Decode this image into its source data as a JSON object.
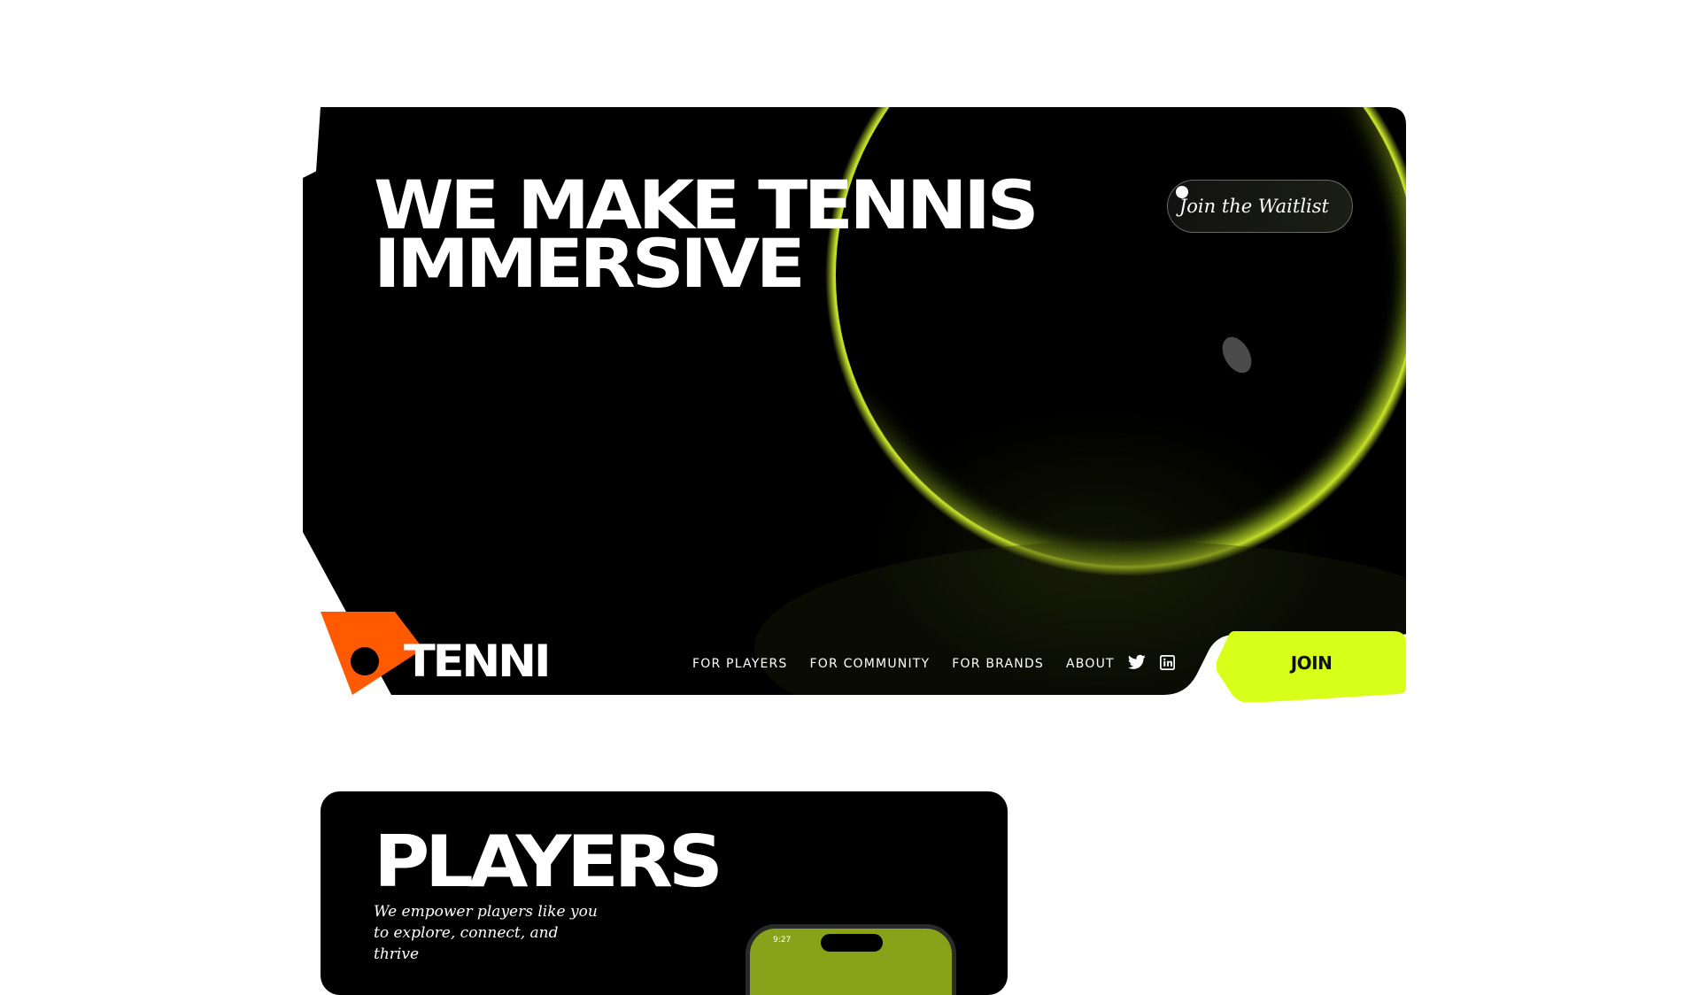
{
  "hero": {
    "title_line1": "WE MAKE TENNIS",
    "title_line2": "IMMERSIVE",
    "waitlist_label": "Join the Waitlist"
  },
  "brand": {
    "name": "TENNI",
    "logo_accent": "#ff5a00"
  },
  "nav": {
    "items": [
      {
        "label": "FOR PLAYERS"
      },
      {
        "label": "FOR COMMUNITY"
      },
      {
        "label": "FOR BRANDS"
      },
      {
        "label": "ABOUT"
      }
    ]
  },
  "socials": {
    "icons": [
      "twitter-icon",
      "linkedin-icon"
    ]
  },
  "join": {
    "label": "JOIN",
    "color": "#d7ff1a"
  },
  "players": {
    "title": "PLAYERS",
    "description": "We empower players like you to explore, connect, and thrive",
    "phone_time": "9:27"
  },
  "colors": {
    "background": "#ffffff",
    "card": "#000000",
    "ball": "#b9d81c",
    "text": "#ffffff"
  }
}
